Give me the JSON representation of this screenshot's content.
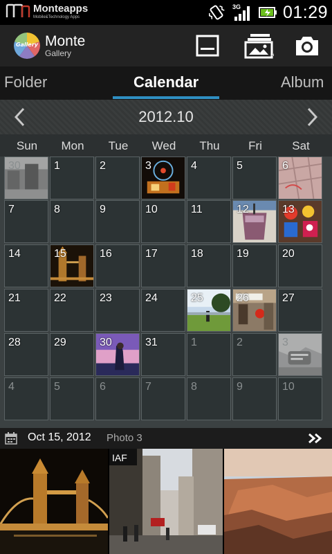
{
  "status_bar": {
    "brand_name": "Monteapps",
    "brand_tagline": "Mobile&Technology Apps",
    "network_label": "3G",
    "time": "01:29",
    "icons": [
      "vibrate-icon",
      "signal-icon",
      "battery-charging-icon"
    ]
  },
  "app_bar": {
    "logo_text": "Gallery",
    "title": "Monte",
    "subtitle": "Gallery",
    "actions": [
      "slideshow-icon",
      "albums-icon",
      "camera-icon"
    ]
  },
  "tabs": [
    {
      "label": "Folder",
      "active": false
    },
    {
      "label": "Calendar",
      "active": true
    },
    {
      "label": "Album",
      "active": false
    }
  ],
  "calendar": {
    "month_label": "2012.10",
    "weekdays": [
      "Sun",
      "Mon",
      "Tue",
      "Wed",
      "Thu",
      "Fri",
      "Sat"
    ],
    "days": [
      {
        "n": "30",
        "other": true,
        "photo": "street-bw"
      },
      {
        "n": "1",
        "other": false,
        "photo": null
      },
      {
        "n": "2",
        "other": false,
        "photo": null
      },
      {
        "n": "3",
        "other": false,
        "photo": "night-ferris"
      },
      {
        "n": "4",
        "other": false,
        "photo": null
      },
      {
        "n": "5",
        "other": false,
        "photo": null
      },
      {
        "n": "6",
        "other": false,
        "photo": "pavement-pink"
      },
      {
        "n": "7",
        "other": false,
        "photo": null
      },
      {
        "n": "8",
        "other": false,
        "photo": null
      },
      {
        "n": "9",
        "other": false,
        "photo": null
      },
      {
        "n": "10",
        "other": false,
        "photo": null
      },
      {
        "n": "11",
        "other": false,
        "photo": null
      },
      {
        "n": "12",
        "other": false,
        "photo": "drink-cup"
      },
      {
        "n": "13",
        "other": false,
        "photo": "toys-colorful"
      },
      {
        "n": "14",
        "other": false,
        "photo": null
      },
      {
        "n": "15",
        "other": false,
        "photo": "tower-bridge"
      },
      {
        "n": "16",
        "other": false,
        "photo": null
      },
      {
        "n": "17",
        "other": false,
        "photo": null
      },
      {
        "n": "18",
        "other": false,
        "photo": null
      },
      {
        "n": "19",
        "other": false,
        "photo": null
      },
      {
        "n": "20",
        "other": false,
        "photo": null
      },
      {
        "n": "21",
        "other": false,
        "photo": null
      },
      {
        "n": "22",
        "other": false,
        "photo": null
      },
      {
        "n": "23",
        "other": false,
        "photo": null
      },
      {
        "n": "24",
        "other": false,
        "photo": null
      },
      {
        "n": "25",
        "other": false,
        "photo": "park-sky"
      },
      {
        "n": "26",
        "other": false,
        "photo": "california-street"
      },
      {
        "n": "27",
        "other": false,
        "photo": null
      },
      {
        "n": "28",
        "other": false,
        "photo": null
      },
      {
        "n": "29",
        "other": false,
        "photo": null
      },
      {
        "n": "30",
        "other": false,
        "photo": "couple-sunset"
      },
      {
        "n": "31",
        "other": false,
        "photo": null
      },
      {
        "n": "1",
        "other": true,
        "photo": null
      },
      {
        "n": "2",
        "other": true,
        "photo": null
      },
      {
        "n": "3",
        "other": true,
        "photo": "zion-sign-bw"
      },
      {
        "n": "4",
        "other": true,
        "photo": null
      },
      {
        "n": "5",
        "other": true,
        "photo": null
      },
      {
        "n": "6",
        "other": true,
        "photo": null
      },
      {
        "n": "7",
        "other": true,
        "photo": null
      },
      {
        "n": "8",
        "other": true,
        "photo": null
      },
      {
        "n": "9",
        "other": true,
        "photo": null
      },
      {
        "n": "10",
        "other": true,
        "photo": null
      }
    ]
  },
  "selection_info": {
    "date": "Oct 15, 2012",
    "count": "Photo 3",
    "icon": "calendar-icon",
    "expand_icon": "double-chevron-right-icon"
  },
  "thumbnails": [
    {
      "name": "tower-bridge-night"
    },
    {
      "name": "city-street"
    },
    {
      "name": "canyon-sunset"
    }
  ],
  "colors": {
    "accent": "#2f8fc2",
    "cell_bg": "#2c3334",
    "grid_line": "#5a6264"
  }
}
